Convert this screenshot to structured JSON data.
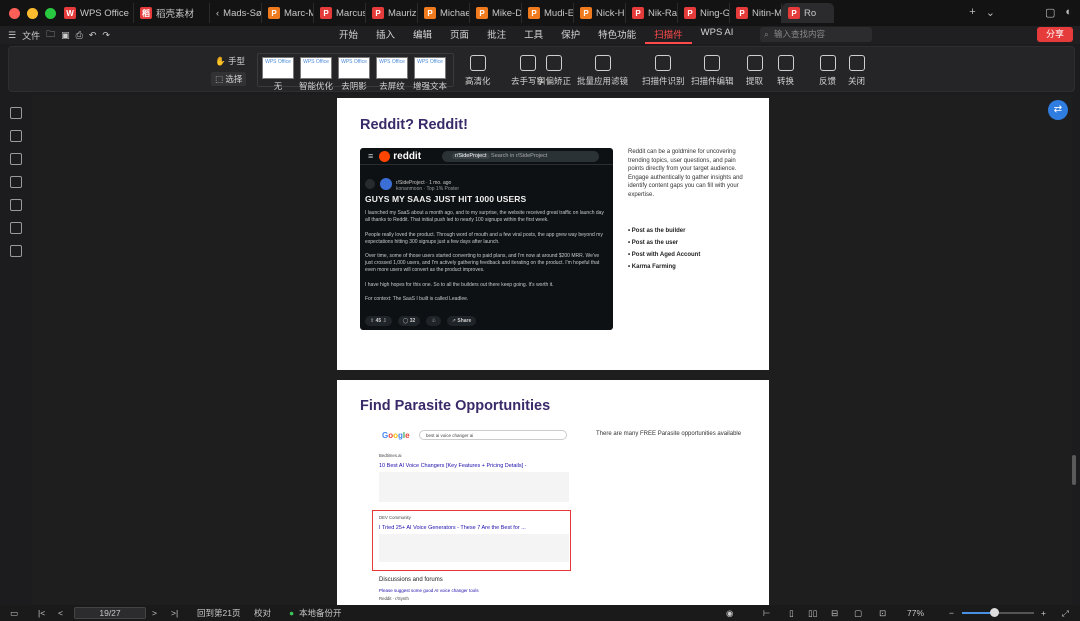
{
  "tabs": [
    {
      "label": "WPS Office",
      "color": "#e63b3b",
      "icon": "W"
    },
    {
      "label": "稻壳素材",
      "color": "#e63b3b",
      "icon": "稻"
    },
    {
      "label": "Mads-Sø",
      "color": "",
      "icon": ""
    },
    {
      "label": "Marc-Mù",
      "color": "#f07b1f",
      "icon": "P"
    },
    {
      "label": "Marcus-i",
      "color": "#e63b3b",
      "icon": "P"
    },
    {
      "label": "Maurizio",
      "color": "#e63b3b",
      "icon": "P"
    },
    {
      "label": "Michael-",
      "color": "#f07b1f",
      "icon": "P"
    },
    {
      "label": "Mike-De",
      "color": "#f07b1f",
      "icon": "P"
    },
    {
      "label": "Mudi-Elo",
      "color": "#f07b1f",
      "icon": "P"
    },
    {
      "label": "Nick-Hu",
      "color": "#f07b1f",
      "icon": "P"
    },
    {
      "label": "Nik-Rang",
      "color": "#e63b3b",
      "icon": "P"
    },
    {
      "label": "Ning-Gao",
      "color": "#e63b3b",
      "icon": "P"
    },
    {
      "label": "Nitin-Ma",
      "color": "#e63b3b",
      "icon": "P"
    },
    {
      "label": "Ro",
      "color": "#e63b3b",
      "icon": "P"
    }
  ],
  "menu": {
    "file": "文件",
    "tabs": [
      "开始",
      "插入",
      "编辑",
      "页面",
      "批注",
      "工具",
      "保护",
      "特色功能",
      "扫描件",
      "WPS AI"
    ],
    "active": "扫描件",
    "search_placeholder": "输入查找内容",
    "share": "分享"
  },
  "toolbar": {
    "hand": "手型",
    "select": "选择",
    "filters": [
      "无",
      "智能优化",
      "去阴影",
      "去屏纹",
      "增强文本"
    ],
    "filter_thumb": "WPS Office",
    "tools": [
      "高清化",
      "去手写字",
      "纠偏矫正",
      "批量应用滤镜",
      "扫描件识别",
      "扫描件编辑",
      "提取",
      "转换",
      "反馈",
      "关闭"
    ]
  },
  "page1": {
    "title": "Reddit? Reddit!",
    "reddit": {
      "logo": "reddit",
      "search_tag": "r/SideProject",
      "search_text": "Search in r/SideProject",
      "meta": "r/SideProject · 1 mo. ago",
      "meta2": "konanmoon · Top 1% Poster",
      "post_title": "GUYS MY SAAS JUST HIT 1000 USERS",
      "p1": "I launched my SaaS about a month ago, and to my surprise, the website received great traffic on launch day all thanks to Reddit. That initial push led to nearly 100 signups within the first week.",
      "p2": "People really loved the product. Through word of mouth and a few viral posts, the app grew way beyond my expectations hitting 300 signups just a few days after launch.",
      "p3": "Over time, some of those users started converting to paid plans, and I'm now at around $200 MRR. We've just crossed 1,000 users, and I'm actively gathering feedback and iterating on the product. I'm hopeful that even more users will convert as the product improves.",
      "p4": "I have high hopes for this one. So to all the builders out there keep going. It's worth it.",
      "p5": "For context: The SaaS I built is called Leadlee.",
      "votes": "45",
      "comments": "32",
      "share": "Share"
    },
    "side_text": "Reddit can be a goldmine for uncovering trending topics, user questions, and pain points directly from your target audience. Engage authentically to gather insights and identify content gaps you can fill with your expertise.",
    "bullets": [
      "Post as the builder",
      "Post as the user",
      "Post with Aged Account",
      "Karma Farming"
    ]
  },
  "page2": {
    "title": "Find Parasite Opportunities",
    "google_query": "best ai voice changer ai",
    "res1_title": "10 Best AI Voice Changers [Key Features + Pricing Details] -",
    "res1_site": "Bedtimes.ai",
    "res2_title": "I Tried 25+ AI Voice Generators - These 7 Are the Best for ...",
    "res2_site": "DEV Community",
    "discussions": "Discussions and forums",
    "forum_link": "Please suggest some good AI voice changer tools",
    "forum_site": "Reddit · r/Synth",
    "side_text": "There are many FREE Parasite opportunities available"
  },
  "status": {
    "page": "19/27",
    "back": "回到第21页",
    "proof": "校对",
    "backup": "本地备份开",
    "zoom": "77%",
    "zoom_fraction": 0.45
  }
}
